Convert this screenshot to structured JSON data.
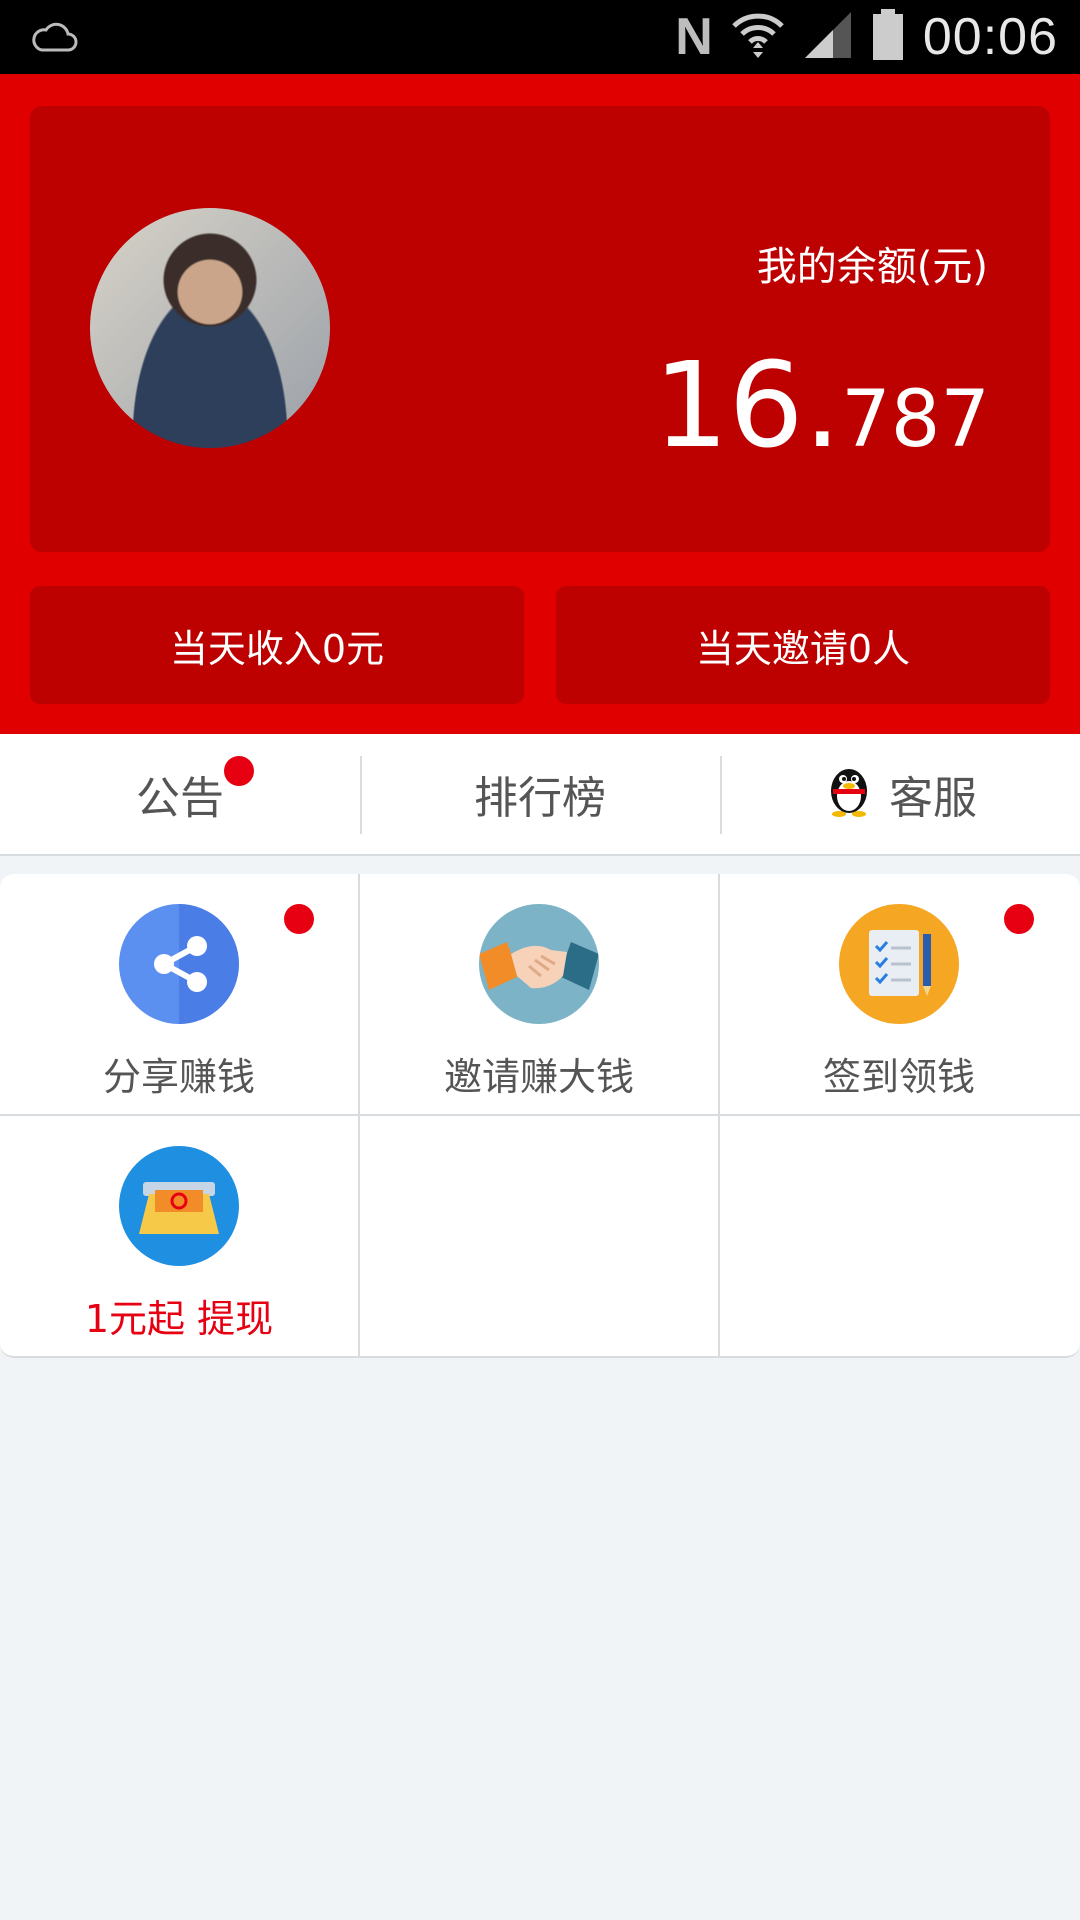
{
  "status_bar": {
    "time": "00:06",
    "nfc_label": "N",
    "icons": [
      "weather-cloud-icon",
      "nfc-icon",
      "wifi-icon",
      "signal-icon",
      "battery-icon"
    ]
  },
  "balance": {
    "label": "我的余额(元)",
    "integer": "16.",
    "decimal": "787"
  },
  "stats": {
    "today_income": "当天收入0元",
    "today_invites": "当天邀请0人"
  },
  "tabs": [
    {
      "label": "公告",
      "badge": true
    },
    {
      "label": "排行榜",
      "badge": false
    },
    {
      "label": "客服",
      "icon": "qq-penguin-icon",
      "badge": false
    }
  ],
  "grid": [
    {
      "label": "分享赚钱",
      "icon": "share-icon",
      "badge": true,
      "color": "#5b8ff0"
    },
    {
      "label": "邀请赚大钱",
      "icon": "handshake-icon",
      "badge": false,
      "color": "#7db3c6"
    },
    {
      "label": "签到领钱",
      "icon": "checklist-icon",
      "badge": true,
      "color": "#f5a623"
    },
    {
      "label": "1元起 提现",
      "icon": "atm-withdraw-icon",
      "badge": false,
      "color": "#1e8fe1",
      "highlight": true
    }
  ],
  "colors": {
    "header_red": "#e00000",
    "card_red": "#bd0000",
    "badge_red": "#e60012",
    "background": "#f0f4f7"
  }
}
